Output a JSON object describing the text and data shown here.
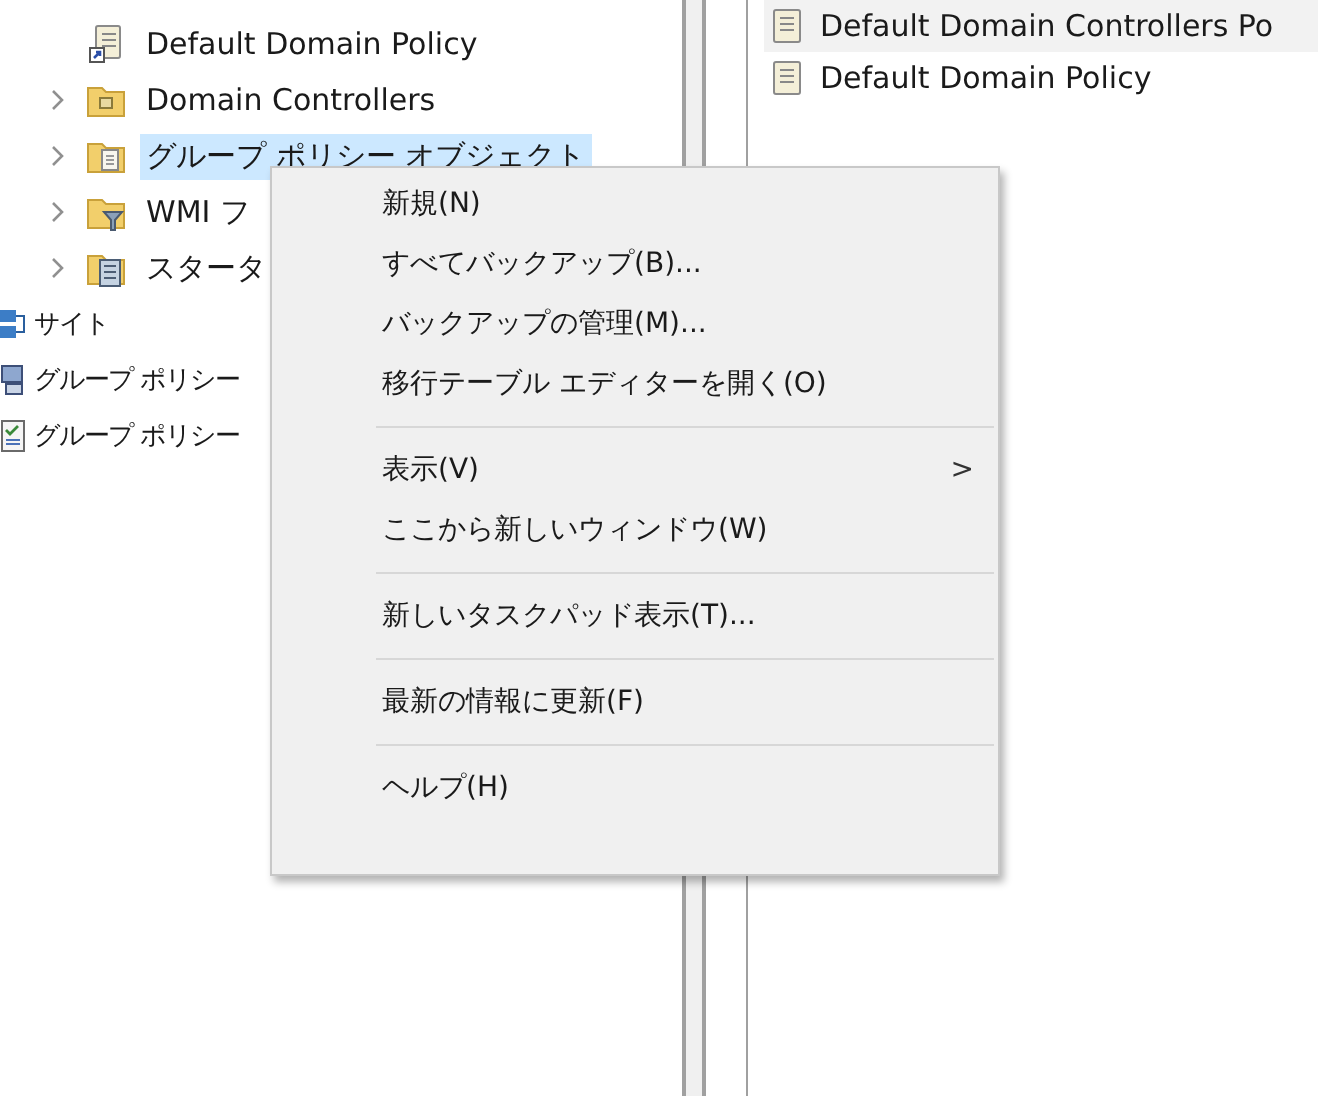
{
  "tree": [
    {
      "label": "Default Domain Policy",
      "expandable": false
    },
    {
      "label": "Domain Controllers",
      "expandable": true,
      "selected": false
    },
    {
      "label": "グループ ポリシー オブジェクト",
      "expandable": true,
      "selected": true
    },
    {
      "label": "WMI フ",
      "expandable": true,
      "selected": false
    },
    {
      "label": "スタータ",
      "expandable": true,
      "selected": false
    }
  ],
  "outer_items": [
    {
      "label": "サイト"
    },
    {
      "label": "グループ ポリシー"
    },
    {
      "label": "グループ ポリシー"
    }
  ],
  "right_list": [
    {
      "label": "Default Domain Controllers Po",
      "selected": true
    },
    {
      "label": "Default Domain Policy",
      "selected": false
    }
  ],
  "context_menu": [
    {
      "kind": "item",
      "label": "新規(N)"
    },
    {
      "kind": "item",
      "label": "すべてバックアップ(B)..."
    },
    {
      "kind": "item",
      "label": "バックアップの管理(M)..."
    },
    {
      "kind": "item",
      "label": "移行テーブル エディターを開く(O)"
    },
    {
      "kind": "separator"
    },
    {
      "kind": "submenu",
      "label": "表示(V)",
      "arrow": ">"
    },
    {
      "kind": "item",
      "label": "ここから新しいウィンドウ(W)"
    },
    {
      "kind": "separator"
    },
    {
      "kind": "item",
      "label": "新しいタスクパッド表示(T)..."
    },
    {
      "kind": "separator"
    },
    {
      "kind": "item",
      "label": "最新の情報に更新(F)"
    },
    {
      "kind": "separator"
    },
    {
      "kind": "item",
      "label": "ヘルプ(H)"
    }
  ]
}
